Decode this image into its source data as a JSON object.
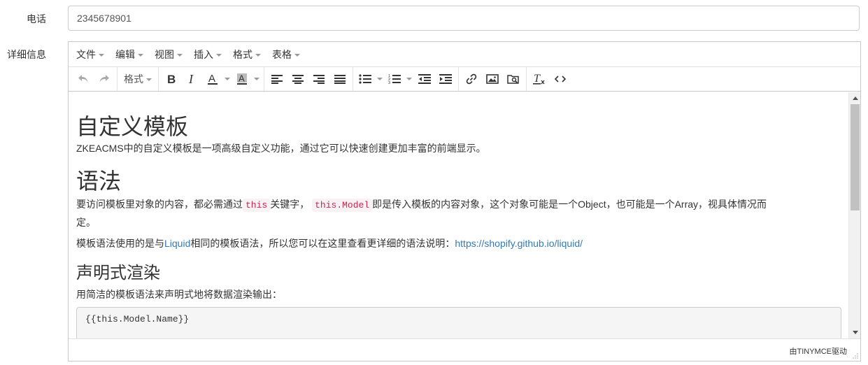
{
  "form": {
    "phone_label": "电话",
    "phone_value": "2345678901",
    "detail_label": "详细信息"
  },
  "editor": {
    "menu": [
      "文件",
      "编辑",
      "视图",
      "插入",
      "格式",
      "表格"
    ],
    "toolbar": {
      "format_label": "格式",
      "icons": [
        "undo-icon",
        "redo-icon",
        "bold-icon",
        "italic-icon",
        "text-color-icon",
        "background-color-icon",
        "align-left-icon",
        "align-center-icon",
        "align-right-icon",
        "align-justify-icon",
        "bullet-list-icon",
        "numbered-list-icon",
        "outdent-icon",
        "indent-icon",
        "link-icon",
        "image-icon",
        "media-browse-icon",
        "clear-format-icon",
        "source-code-icon"
      ]
    },
    "content": {
      "heading1": "自定义模板",
      "intro": "ZKEACMS中的自定义模板是一项高级自定义功能，通过它可以快速创建更加丰富的前端显示。",
      "heading2": "语法",
      "syntax_p1_a": "要访问模板里对象的内容，都必需通过",
      "syntax_code1": "this",
      "syntax_p1_b": "关键字，",
      "syntax_code2": "this.Model",
      "syntax_p1_c": "即是传入模板的内容对象，这个对象可能是一个Object，也可能是一个Array，视具体情况而",
      "syntax_p1_d": "定。",
      "syntax_p2_a": "模板语法使用的是与",
      "syntax_p2_link1": "Liquid",
      "syntax_p2_b": "相同的模板语法，所以您可以在这里查看更详细的语法说明：",
      "syntax_p2_link2": "https://shopify.github.io/liquid/",
      "heading3": "声明式渲染",
      "render_p": "用简洁的模板语法来声明式地将数据渲染输出：",
      "code_block": "{{this.Model.Name}}"
    },
    "branding": "由TINYMCE驱动"
  },
  "colors": {
    "link": "#337ab7",
    "inline_code_text": "#c7254e",
    "inline_code_bg": "#f9f2f4"
  }
}
